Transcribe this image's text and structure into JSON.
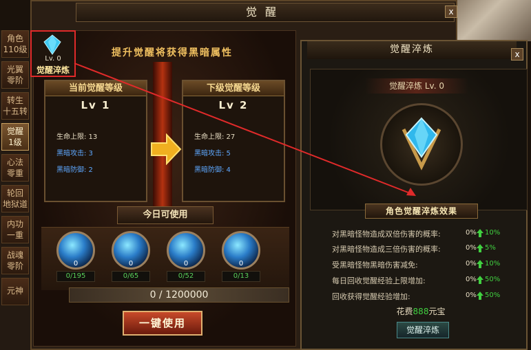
{
  "tabs": [
    {
      "line1": "角色",
      "line2": "110级"
    },
    {
      "line1": "光翼",
      "line2": "零阶"
    },
    {
      "line1": "转生",
      "line2": "十五转"
    },
    {
      "line1": "觉醒",
      "line2": "1级"
    },
    {
      "line1": "心法",
      "line2": "零重"
    },
    {
      "line1": "轮回",
      "line2": "地狱道"
    },
    {
      "line1": "内功",
      "line2": "一重"
    },
    {
      "line1": "战魂",
      "line2": "零阶"
    },
    {
      "line1": "元神",
      "line2": ""
    }
  ],
  "main": {
    "title": "觉醒",
    "close": "x",
    "headline": "提升觉醒将获得黑暗属性",
    "icon": {
      "level": "Lv. 0",
      "name": "觉醒淬炼"
    },
    "current": {
      "header": "当前觉醒等级",
      "level": "Lv 1",
      "hp": "生命上限: 13",
      "atk": "黑暗攻击: 3",
      "def": "黑暗防御: 2"
    },
    "next": {
      "header": "下级觉醒等级",
      "level": "Lv 2",
      "hp": "生命上限: 27",
      "atk": "黑暗攻击: 5",
      "def": "黑暗防御: 4"
    },
    "today_label": "今日可使用",
    "items": [
      {
        "count": "0",
        "total": "0/195"
      },
      {
        "count": "0",
        "total": "0/65"
      },
      {
        "count": "0",
        "total": "0/52"
      },
      {
        "count": "0",
        "total": "0/13"
      }
    ],
    "progress": "0 / 1200000",
    "onekey": "一键使用"
  },
  "dialog": {
    "title": "觉醒淬炼",
    "close": "x",
    "name": "觉醒淬炼  Lv. 0",
    "effect_title": "角色觉醒淬炼效果",
    "effects": [
      {
        "label": "对黑暗怪物造成双倍伤害的概率:",
        "value": "0%",
        "plus": "10%"
      },
      {
        "label": "对黑暗怪物造成三倍伤害的概率:",
        "value": "0%",
        "plus": "5%"
      },
      {
        "label": "受黑暗怪物黑暗伤害减免:",
        "value": "0%",
        "plus": "10%"
      },
      {
        "label": "每日回收觉醒经验上限增加:",
        "value": "0%",
        "plus": "50%"
      },
      {
        "label": "回收获得觉醒经验增加:",
        "value": "0%",
        "plus": "50%"
      }
    ],
    "cost_prefix": "花费",
    "cost_amount": "888",
    "cost_suffix": "元宝",
    "button": "觉醒淬炼"
  },
  "colors": {
    "accent_gold": "#f0c060",
    "stat_blue": "#5ea8ff",
    "plus_green": "#40d040",
    "annotation_red": "#e02a2a"
  }
}
